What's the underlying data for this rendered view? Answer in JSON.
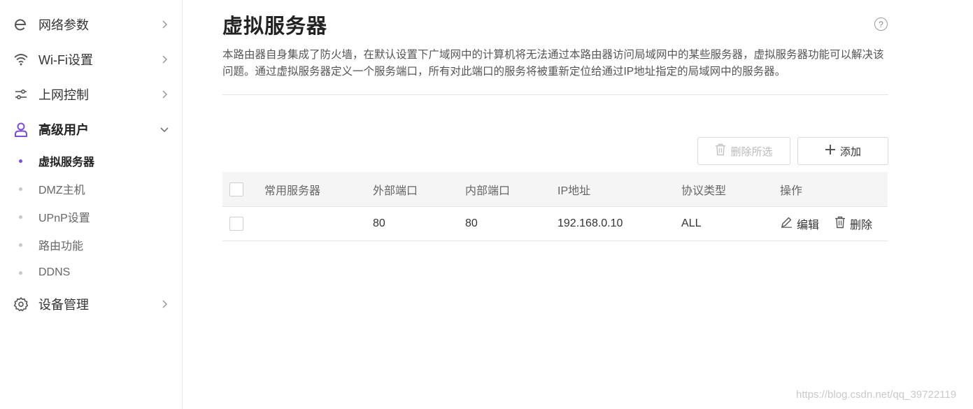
{
  "sidebar": {
    "items": [
      {
        "label": "网络参数",
        "icon": "e-icon"
      },
      {
        "label": "Wi-Fi设置",
        "icon": "wifi-icon"
      },
      {
        "label": "上网控制",
        "icon": "sliders-icon"
      },
      {
        "label": "高级用户",
        "icon": "user-icon"
      },
      {
        "label": "设备管理",
        "icon": "gear-icon"
      }
    ],
    "sub_items": [
      {
        "label": "虚拟服务器"
      },
      {
        "label": "DMZ主机"
      },
      {
        "label": "UPnP设置"
      },
      {
        "label": "路由功能"
      },
      {
        "label": "DDNS"
      }
    ],
    "accent_color": "#7b4fd6"
  },
  "main": {
    "title": "虚拟服务器",
    "help_symbol": "?",
    "description": "本路由器自身集成了防火墙，在默认设置下广域网中的计算机将无法通过本路由器访问局域网中的某些服务器，虚拟服务器功能可以解决该问题。通过虚拟服务器定义一个服务端口，所有对此端口的服务将被重新定位给通过IP地址指定的局域网中的服务器。",
    "delete_selected_label": "删除所选",
    "add_label": "添加"
  },
  "table": {
    "headers": {
      "service": "常用服务器",
      "external_port": "外部端口",
      "internal_port": "内部端口",
      "ip": "IP地址",
      "protocol": "协议类型",
      "action": "操作"
    },
    "rows": [
      {
        "service": "",
        "external_port": "80",
        "internal_port": "80",
        "ip": "192.168.0.10",
        "protocol": "ALL",
        "edit_label": "编辑",
        "delete_label": "删除"
      }
    ]
  },
  "watermark": "https://blog.csdn.net/qq_39722119"
}
